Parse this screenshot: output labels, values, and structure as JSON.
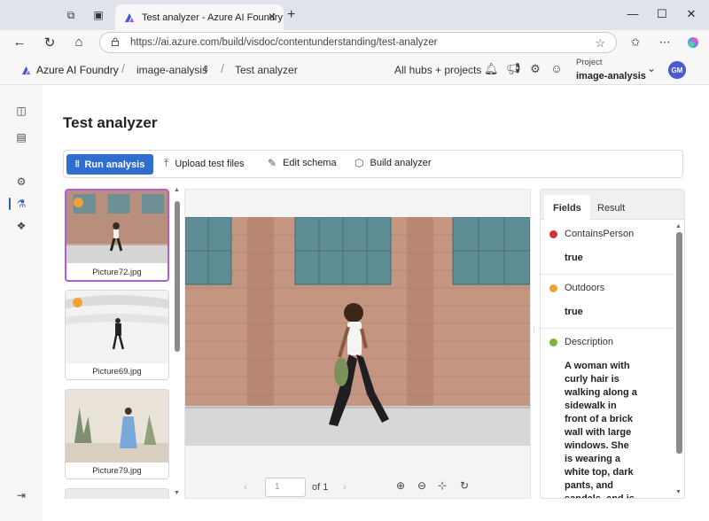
{
  "browser": {
    "tab_title": "Test analyzer - Azure AI Foundry",
    "url": "https://ai.azure.com/build/visdoc/contentunderstanding/test-analyzer"
  },
  "header": {
    "brand": "Azure AI Foundry",
    "crumb_project": "image-analysis",
    "crumb_page": "Test analyzer",
    "hubs": "All hubs + projects",
    "project_label": "Project",
    "project_name": "image-analysis",
    "avatar": "GM"
  },
  "page": {
    "title": "Test analyzer"
  },
  "toolbar": {
    "run": "Run analysis",
    "upload": "Upload test files",
    "edit": "Edit schema",
    "build": "Build analyzer"
  },
  "thumbnails": [
    {
      "name": "Picture72.jpg"
    },
    {
      "name": "Picture69.jpg"
    },
    {
      "name": "Picture79.jpg"
    }
  ],
  "viewer": {
    "page_input": "1",
    "page_total": "of 1"
  },
  "panel": {
    "tab_fields": "Fields",
    "tab_result": "Result",
    "fields": [
      {
        "name": "ContainsPerson",
        "value": "true",
        "color": "#d13438"
      },
      {
        "name": "Outdoors",
        "value": "true",
        "color": "#f0a23a"
      },
      {
        "name": "Description",
        "value": "A woman with curly hair is walking along a sidewalk in front of a brick wall with large windows. She is wearing a white top, dark pants, and sandals, and is carrying",
        "color": "#7ab733"
      }
    ]
  },
  "colors": {
    "accent": "#2f6ed0",
    "selected_border": "#b45fd0"
  }
}
